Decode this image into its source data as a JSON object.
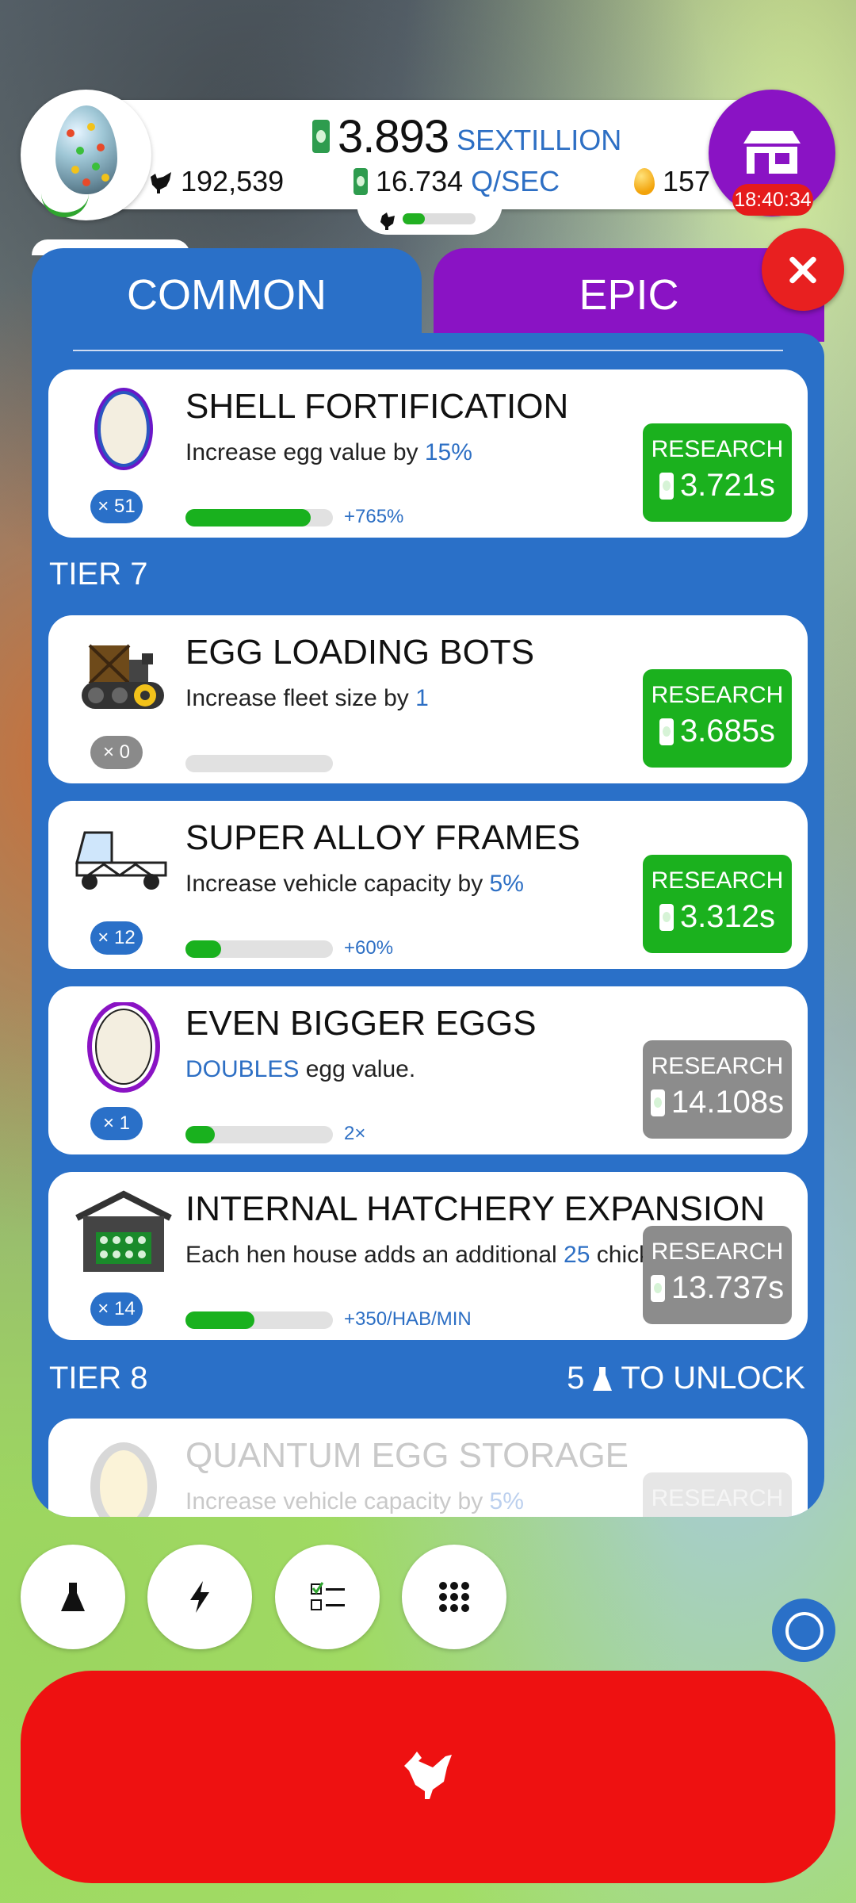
{
  "hud": {
    "money_value": "3.893",
    "money_unit": "SEXTILLION",
    "chickens": "192,539",
    "rate_value": "16.734",
    "rate_unit": "Q/SEC",
    "golden_eggs": "157",
    "shop_timer": "18:40:34",
    "habitat_fill": 0.3
  },
  "tabs": {
    "common": "COMMON",
    "epic": "EPIC"
  },
  "research": [
    {
      "title": "SHELL FORTIFICATION",
      "desc_pre": "Increase egg value by ",
      "desc_hl": "15%",
      "desc_post": "",
      "count": "× 51",
      "progress": 0.85,
      "bonus": "+765%",
      "button": "RESEARCH",
      "cost": "3.721s",
      "available": true
    },
    {
      "title": "EGG LOADING BOTS",
      "desc_pre": "Increase fleet size by ",
      "desc_hl": "1",
      "desc_post": "",
      "count": "× 0",
      "progress": 0,
      "bonus": "",
      "button": "RESEARCH",
      "cost": "3.685s",
      "available": true
    },
    {
      "title": "SUPER ALLOY FRAMES",
      "desc_pre": "Increase vehicle capacity by ",
      "desc_hl": "5%",
      "desc_post": "",
      "count": "× 12",
      "progress": 0.24,
      "bonus": "+60%",
      "button": "RESEARCH",
      "cost": "3.312s",
      "available": true
    },
    {
      "title": "EVEN BIGGER EGGS",
      "desc_pre": "",
      "desc_hl": "DOUBLES",
      "desc_post": " egg value.",
      "count": "× 1",
      "progress": 0.2,
      "bonus": "2×",
      "button": "RESEARCH",
      "cost": "14.108s",
      "available": false
    },
    {
      "title": "INTERNAL HATCHERY EXPANSION",
      "desc_pre": "Each hen house adds an additional ",
      "desc_hl": "25",
      "desc_post": " chickens/min",
      "count": "× 14",
      "progress": 0.47,
      "bonus": "+350/HAB/MIN",
      "button": "RESEARCH",
      "cost": "13.737s",
      "available": false
    },
    {
      "title": "QUANTUM EGG STORAGE",
      "desc_pre": "Increase vehicle capacity by ",
      "desc_hl": "5%",
      "desc_post": "",
      "count": "",
      "progress": 0,
      "bonus": "",
      "button": "RESEARCH",
      "cost": "",
      "available": false
    }
  ],
  "tiers": {
    "tier7": "TIER 7",
    "tier8": "TIER 8",
    "unlock_count": "5",
    "unlock_text": "TO UNLOCK"
  },
  "icons": {
    "cash": "cash-icon",
    "chicken": "chicken-icon",
    "golden_egg": "golden-egg-icon",
    "shop": "shop-icon",
    "close": "close-icon",
    "flask": "flask-icon",
    "lightning": "lightning-icon",
    "checklist": "checklist-icon",
    "grid": "grid-icon"
  },
  "colors": {
    "panel": "#2a70c8",
    "epic": "#8a13c4",
    "research_green": "#1bb11e",
    "research_gray": "#8c8c8c",
    "hatch_red": "#ee1111"
  }
}
